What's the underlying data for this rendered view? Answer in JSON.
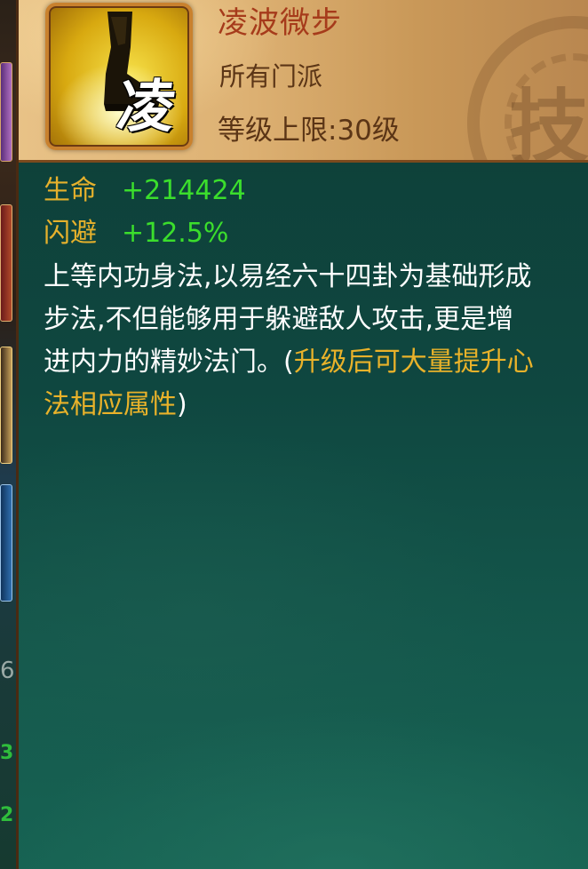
{
  "skill": {
    "name": "凌波微步",
    "icon_glyph": "凌",
    "icon": "boot-icon",
    "sect": "所有门派",
    "level_label": "等级上限:",
    "level_value": "30级",
    "header_seal_glyph": "技"
  },
  "stats": [
    {
      "name": "生命",
      "value": "+214424"
    },
    {
      "name": "闪避",
      "value": "+12.5%"
    }
  ],
  "description": {
    "line1": "上等内功身法,以易经六十四卦为基础形成",
    "line2": "步法,不但能够用于躲避敌人攻击,更是增",
    "line3_plain": "进内力的精妙法门。(",
    "line3_highlight": "升级后可大量提升心",
    "line4_highlight": "法相应属性",
    "line4_plain": ")"
  },
  "left_strip": {
    "digit": "6",
    "green_text_1": "3",
    "green_text_2": "2"
  },
  "colors": {
    "panel_bg": "#0f4740",
    "header_bg": "#ddb173",
    "skill_name": "#a63b1b",
    "stat_name": "#e6b12c",
    "stat_value": "#3bde2c",
    "description_text": "#ffffff",
    "description_highlight": "#e9b22a"
  }
}
